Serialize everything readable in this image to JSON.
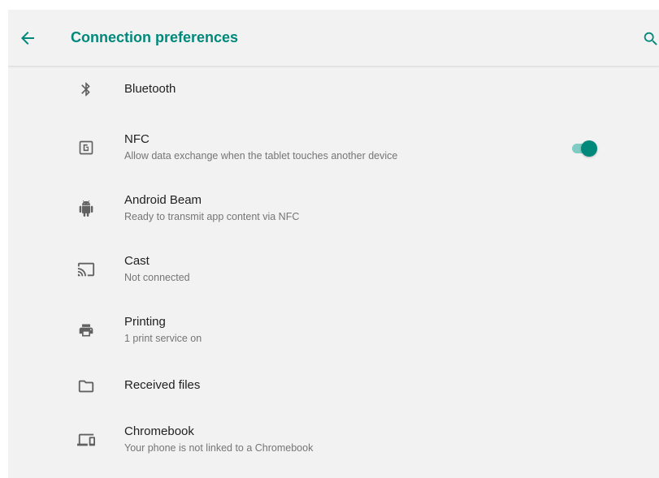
{
  "header": {
    "title": "Connection preferences",
    "back_icon": "arrow-back-icon",
    "search_icon": "search-icon"
  },
  "colors": {
    "accent": "#00897b",
    "toggle_track": "#80cbc4",
    "background": "#f2f2f2",
    "title_text": "#212121",
    "summary_text": "#757575",
    "icon": "#616161"
  },
  "items": [
    {
      "title": "Bluetooth",
      "summary": "",
      "icon": "bluetooth-icon"
    },
    {
      "title": "NFC",
      "summary": "Allow data exchange when the tablet touches another device",
      "icon": "nfc-icon",
      "toggle_on": true
    },
    {
      "title": "Android Beam",
      "summary": "Ready to transmit app content via NFC",
      "icon": "android-icon"
    },
    {
      "title": "Cast",
      "summary": "Not connected",
      "icon": "cast-icon"
    },
    {
      "title": "Printing",
      "summary": "1 print service on",
      "icon": "printer-icon"
    },
    {
      "title": "Received files",
      "summary": "",
      "icon": "folder-icon"
    },
    {
      "title": "Chromebook",
      "summary": "Your phone is not linked to a Chromebook",
      "icon": "devices-icon"
    }
  ]
}
